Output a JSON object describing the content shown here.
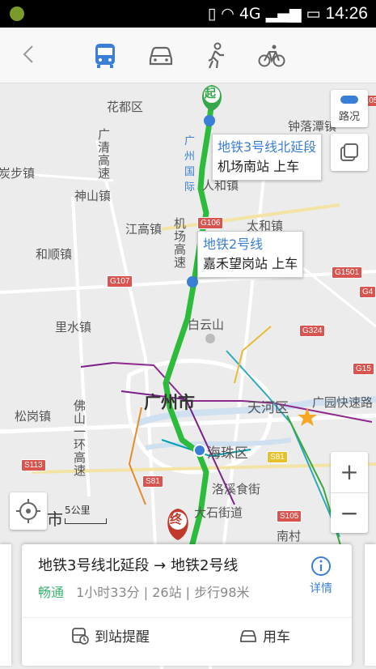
{
  "status_bar": {
    "time": "14:26",
    "network": "4G"
  },
  "transport_modes": [
    {
      "name": "bus-icon",
      "active": true
    },
    {
      "name": "car-icon",
      "active": false
    },
    {
      "name": "walk-icon",
      "active": false
    },
    {
      "name": "bike-icon",
      "active": false
    }
  ],
  "map": {
    "places": {
      "huadu": "花都区",
      "zhongluotan": "钟落潭镇",
      "tanbu": "炭步镇",
      "shenshan": "神山镇",
      "jianggao": "江高镇",
      "taihe": "太和镇",
      "renhe": "人和镇",
      "hedun": "和顺镇",
      "lishui": "里水镇",
      "baiyunshan": "白云山",
      "guangzhou": "广州市",
      "tianhe": "天河区",
      "songgang": "松岗镇",
      "haizhu": "海珠区",
      "luoxi": "洛溪食街",
      "dashi": "大石街道",
      "nancun": "南村",
      "qingyuan_hwy": "广清高速",
      "airport_hwy": "机场高速",
      "foshan_ring": "佛山一环高速",
      "guangyuan_hwy": "广园快速路",
      "airport_label": "广州国际",
      "city_fragment": "市"
    },
    "road_badges": [
      "S105",
      "G106",
      "G1501",
      "G107",
      "G4",
      "G324",
      "G15",
      "S81",
      "S113",
      "S81",
      "S105"
    ],
    "start_marker": "起",
    "end_marker": "终",
    "callout1": {
      "line": "地铁3号线北延段",
      "stop": "机场南站 上车"
    },
    "callout2": {
      "line": "地铁2号线",
      "stop": "嘉禾望岗站 上车"
    },
    "traffic_label": "路况",
    "zoom_in": "+",
    "zoom_out": "−",
    "scale": "5公里"
  },
  "route_card": {
    "route": "地铁3号线北延段 → 地铁2号线",
    "status": "畅通",
    "summary": "1小时33分 | 26站 | 步行98米",
    "detail": "详情",
    "remind": "到站提醒",
    "car": "用车"
  },
  "colors": {
    "route": "#2dbb3b",
    "accent": "#3a7fd5",
    "status_good": "#3cb371",
    "marker_start": "#37a84a",
    "marker_end": "#c0392b"
  }
}
